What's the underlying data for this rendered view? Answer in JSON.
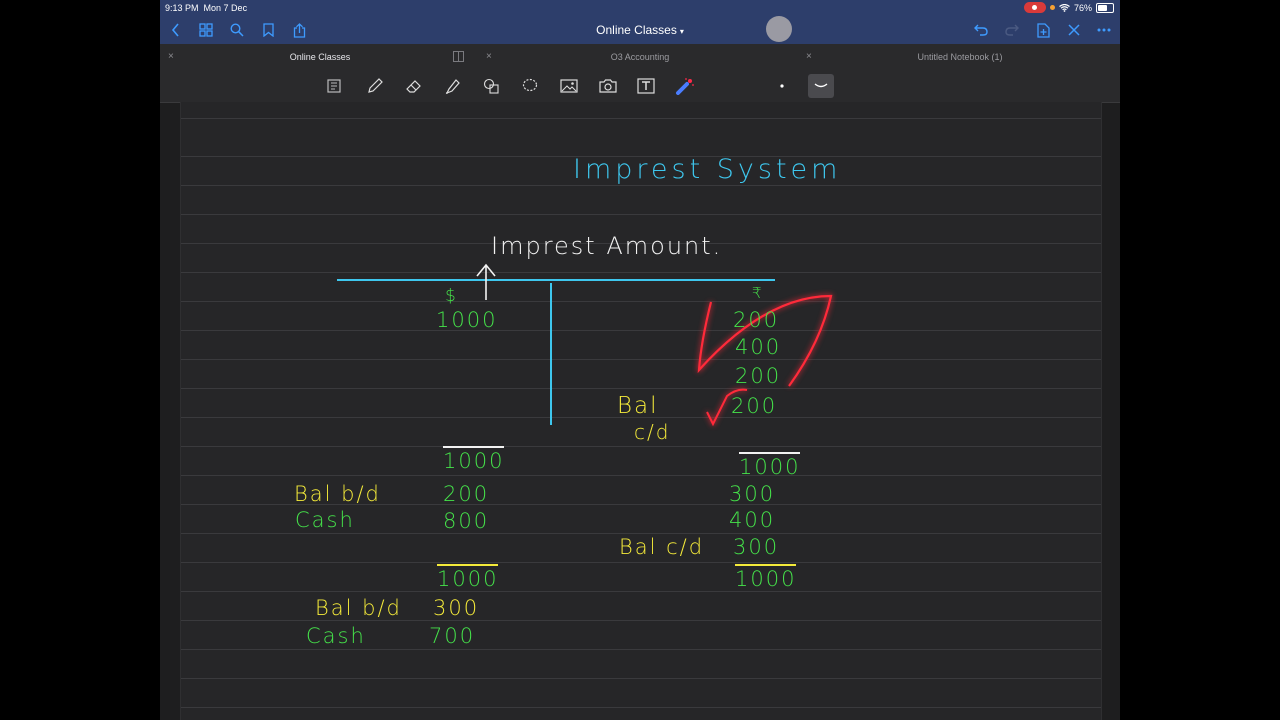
{
  "status_bar": {
    "time": "9:13 PM",
    "date": "Mon 7 Dec",
    "battery": "76%",
    "battery_level": 0.76
  },
  "nav": {
    "title": "Online Classes"
  },
  "tabs": [
    {
      "label": "Online Classes"
    },
    {
      "label": "O3 Accounting"
    },
    {
      "label": "Untitled Notebook (1)"
    }
  ],
  "toolbar_icons": [
    "read-only-icon",
    "pen-icon",
    "eraser-icon",
    "highlighter-icon",
    "shapes-icon",
    "lasso-icon",
    "image-icon",
    "camera-icon",
    "text-icon",
    "laser-pointer-icon",
    "thin-stroke-icon",
    "stroke-style-icon"
  ],
  "notes": {
    "heading": "Imprest System",
    "subheading": "Imprest Amount.",
    "debit_symbol": "$",
    "debit_amount": "1000",
    "credit_symbol": "₹",
    "credit_1": "200",
    "credit_2": "400",
    "credit_3": "200",
    "bal_label": "Bal",
    "cd_label": "c/d",
    "credit_bal": "200",
    "total_left_1": "1000",
    "total_right_1": "1000",
    "bal_bd_1": "Bal b/d",
    "bal_bd_1_val": "200",
    "cash_1": "Cash",
    "cash_1_val": "800",
    "right_300": "300",
    "right_400": "400",
    "bal_cd_2": "Bal c/d",
    "bal_cd_2_val": "300",
    "total_left_2": "1000",
    "total_right_2": "1000",
    "bal_bd_2": "Bal b/d",
    "bal_bd_2_val": "300",
    "cash_2": "Cash",
    "cash_2_val": "700"
  },
  "colors": {
    "bar": "#2d3e6b",
    "cyan": "#3ec7ee",
    "green": "#45e24a",
    "yellow": "#f4ea3a",
    "red": "#ff2a3a"
  }
}
